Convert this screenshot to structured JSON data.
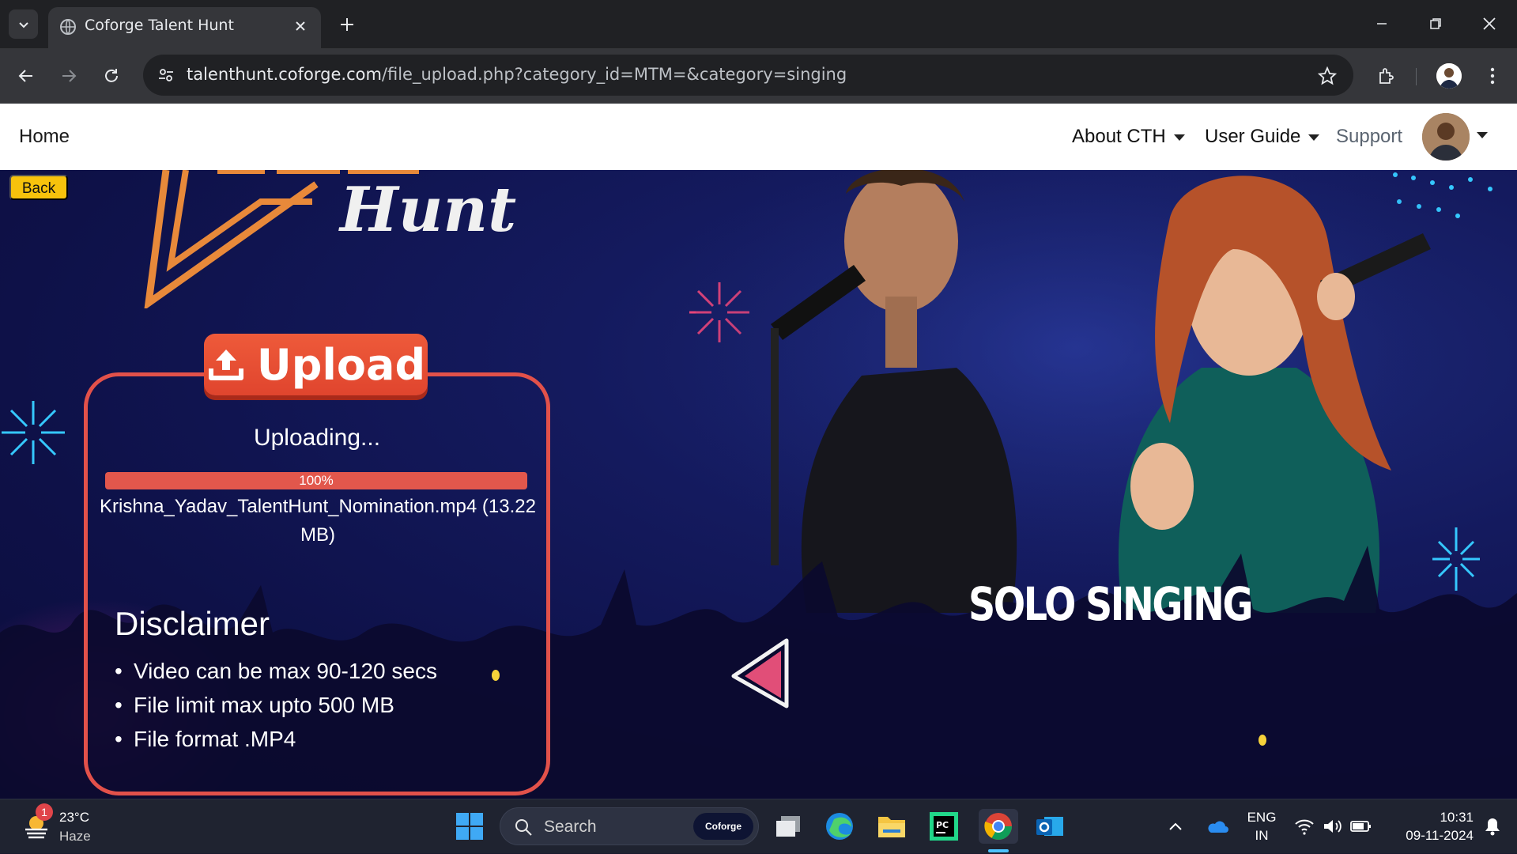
{
  "browser": {
    "tab_title": "Coforge Talent Hunt",
    "url_host": "talenthunt.coforge.com",
    "url_path": "/file_upload.php?category_id=MTM=&category=singing"
  },
  "navbar": {
    "home": "Home",
    "about": "About CTH",
    "user_guide": "User Guide",
    "support": "Support"
  },
  "page": {
    "back": "Back",
    "logo_text": "Hunt",
    "upload_label": "Upload",
    "status": "Uploading...",
    "progress_percent": 100,
    "progress_label": "100%",
    "file_name": "Krishna_Yadav_TalentHunt_Nomination.mp4 (13.22 MB)",
    "disclaimer_title": "Disclaimer",
    "disclaimer_items": [
      "Video can be max 90-120 secs",
      "File limit max upto 500 MB",
      "File format .MP4"
    ],
    "category_title": "SOLO SINGING"
  },
  "taskbar": {
    "weather_temp": "23°C",
    "weather_desc": "Haze",
    "weather_badge": "1",
    "search": "Search",
    "search_badge": "Coforge",
    "lang": "ENG",
    "region": "IN",
    "time": "10:31",
    "date": "09-11-2024"
  },
  "colors": {
    "accent": "#e2514a",
    "back_button": "#f7c20c",
    "hero_bg": "#141a5e"
  }
}
